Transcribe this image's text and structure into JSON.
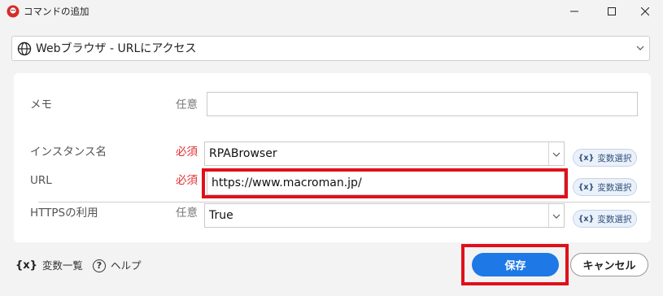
{
  "window": {
    "title": "コマンドの追加"
  },
  "command": {
    "selected": "Webブラウザ - URLにアクセス"
  },
  "form": {
    "memo": {
      "label": "メモ",
      "requirement": "任意",
      "value": ""
    },
    "instance": {
      "label": "インスタンス名",
      "requirement": "必須",
      "value": "RPABrowser",
      "var_button": "変数選択"
    },
    "url": {
      "label": "URL",
      "requirement": "必須",
      "value": "https://www.macroman.jp/",
      "var_button": "変数選択"
    },
    "https": {
      "label": "HTTPSの利用",
      "requirement": "任意",
      "value": "True",
      "var_button": "変数選択"
    }
  },
  "var_glyph": "{x}",
  "footer": {
    "variables_label": "変数一覧",
    "help_label": "ヘルプ",
    "save_label": "保存",
    "cancel_label": "キャンセル"
  },
  "colors": {
    "accent": "#1e78e6",
    "required": "#e03030",
    "highlight": "#e0101a"
  }
}
